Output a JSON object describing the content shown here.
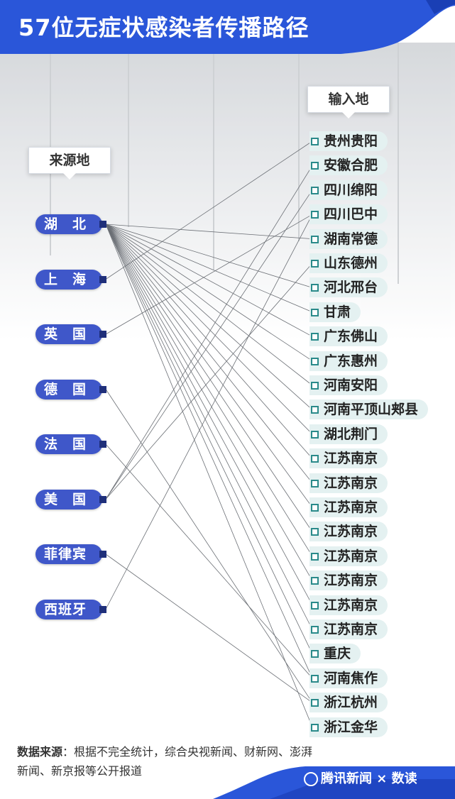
{
  "title": "57位无症状感染者传播路径",
  "source_header": "来源地",
  "dest_header": "输入地",
  "sources": [
    "湖　北",
    "上　海",
    "英　国",
    "德　国",
    "法　国",
    "美　国",
    "菲律宾",
    "西班牙"
  ],
  "destinations": [
    "贵州贵阳",
    "安徽合肥",
    "四川绵阳",
    "四川巴中",
    "湖南常德",
    "山东德州",
    "河北邢台",
    "甘肃",
    "广东佛山",
    "广东惠州",
    "河南安阳",
    "河南平顶山郏县",
    "湖北荆门",
    "江苏南京",
    "江苏南京",
    "江苏南京",
    "江苏南京",
    "江苏南京",
    "江苏南京",
    "江苏南京",
    "江苏南京",
    "重庆",
    "河南焦作",
    "浙江杭州",
    "浙江金华"
  ],
  "links": [
    [
      0,
      4
    ],
    [
      0,
      6
    ],
    [
      0,
      7
    ],
    [
      0,
      8
    ],
    [
      0,
      9
    ],
    [
      0,
      10
    ],
    [
      0,
      11
    ],
    [
      0,
      12
    ],
    [
      0,
      13
    ],
    [
      0,
      14
    ],
    [
      0,
      15
    ],
    [
      0,
      16
    ],
    [
      0,
      17
    ],
    [
      0,
      18
    ],
    [
      0,
      19
    ],
    [
      0,
      20
    ],
    [
      0,
      21
    ],
    [
      0,
      22
    ],
    [
      0,
      24
    ],
    [
      1,
      0
    ],
    [
      2,
      3
    ],
    [
      3,
      23
    ],
    [
      4,
      22
    ],
    [
      5,
      1
    ],
    [
      5,
      2
    ],
    [
      5,
      5
    ],
    [
      6,
      23
    ],
    [
      7,
      3
    ]
  ],
  "footnote_label": "数据来源",
  "footnote_text": "：根据不完全统计，综合央视新闻、财新网、澎湃新闻、新京报等公开报道",
  "brand": "腾讯新闻 × 数读",
  "colors": {
    "header": "#2a56d9",
    "source": "#3f57c9",
    "dest_bg": "#e4f1f1",
    "dest_marker": "#2a8a8a"
  }
}
